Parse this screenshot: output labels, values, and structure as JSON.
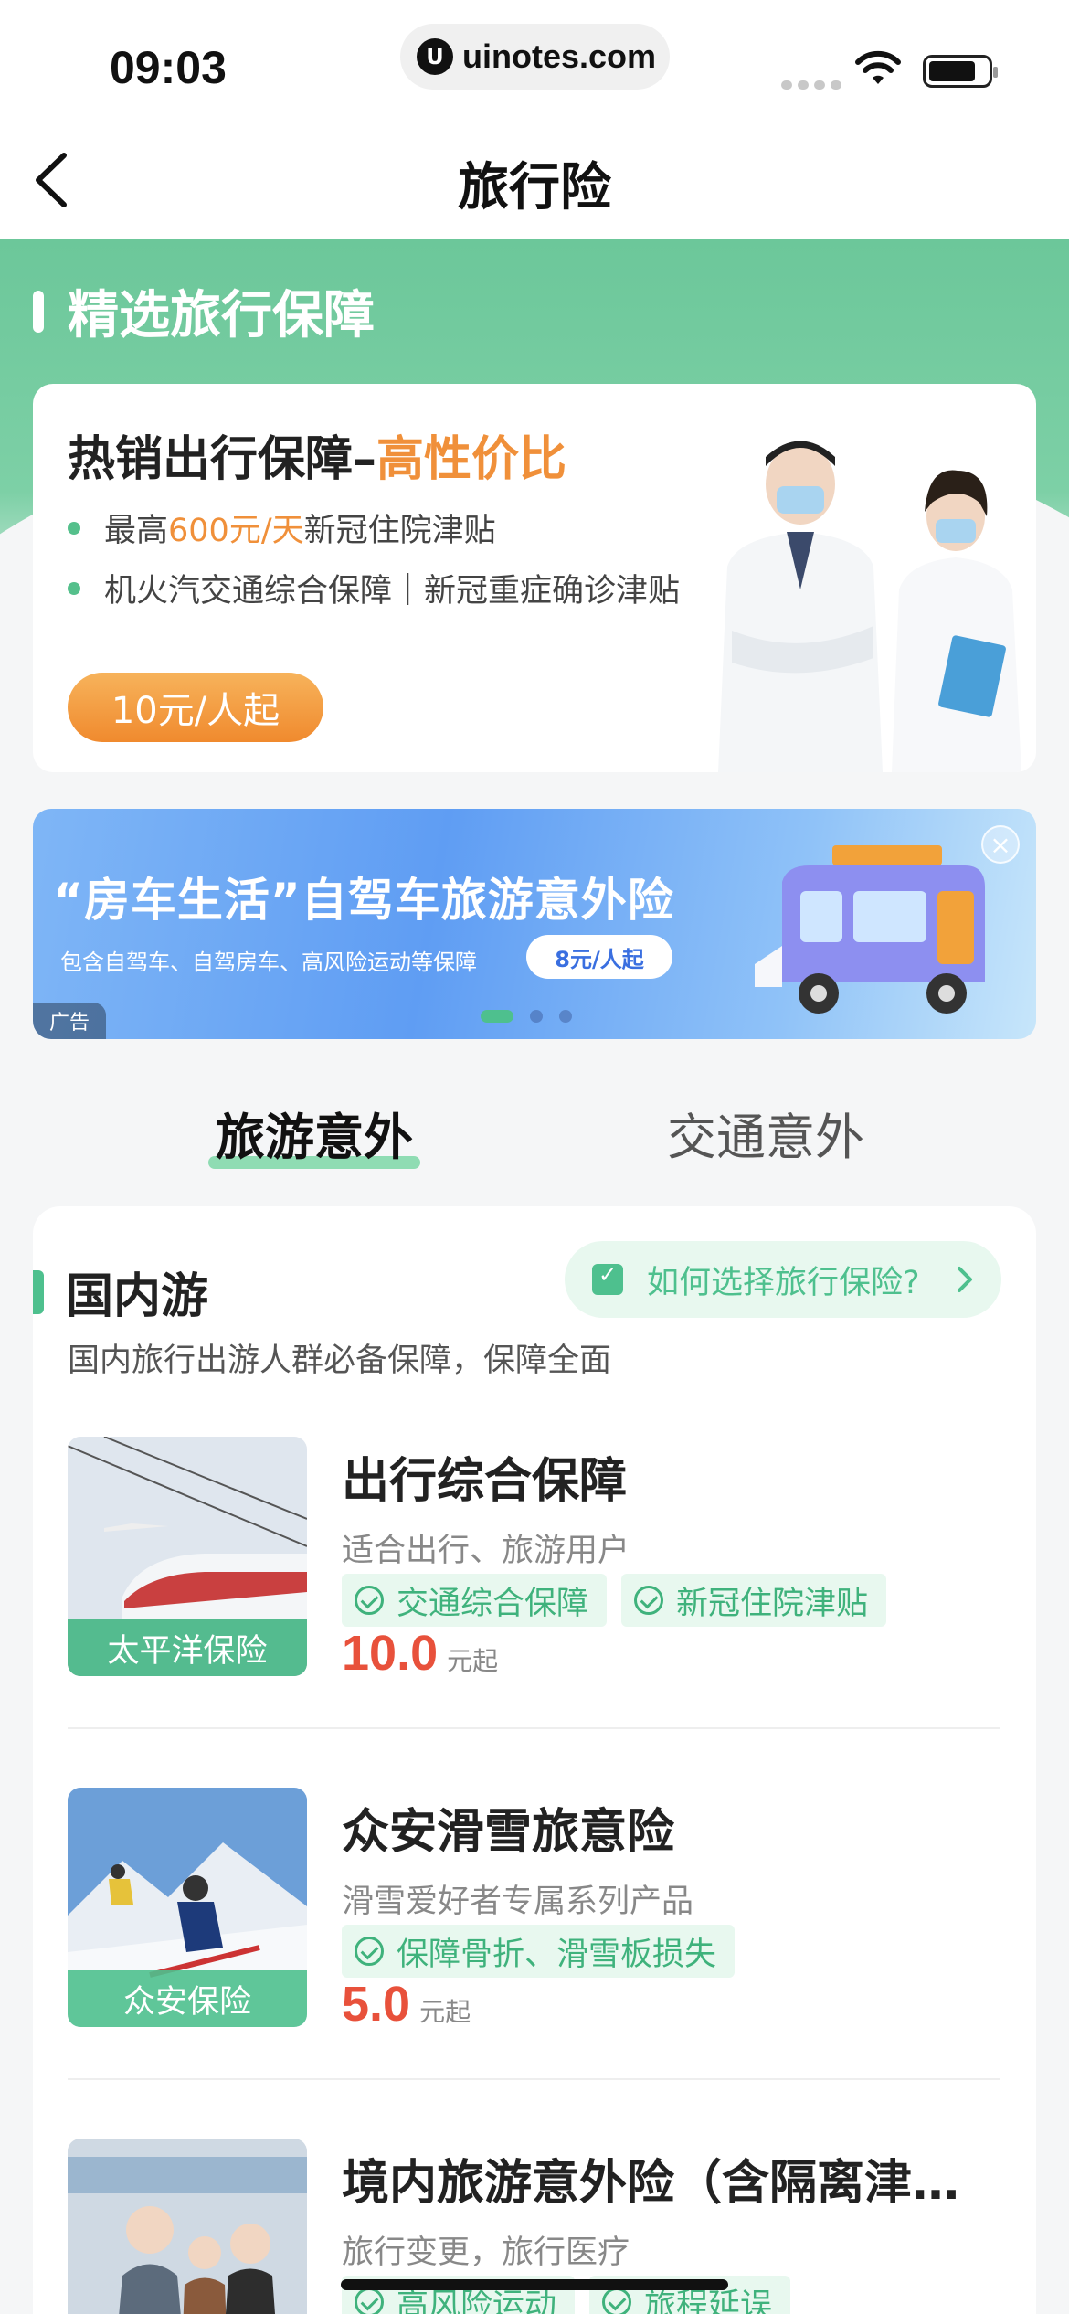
{
  "status_bar": {
    "time": "09:03",
    "url": "uinotes.com"
  },
  "nav": {
    "title": "旅行险"
  },
  "hero": {
    "section_title": "精选旅行保障"
  },
  "promo": {
    "title_prefix": "热销出行保障–",
    "title_highlight": "高性价比",
    "bullet1_pre": "最高",
    "bullet1_hl": "600元/天",
    "bullet1_post": "新冠住院津贴",
    "bullet2": "机火汽交通综合保障｜新冠重症确诊津贴",
    "button": "10元/人起"
  },
  "ad": {
    "title": "“房车生活”自驾车旅游意外险",
    "subtitle": "包含自驾车、自驾房车、高风险运动等保障",
    "price": "8元/人起",
    "tag": "广告",
    "close": "×",
    "slides": 3,
    "active_slide": 1
  },
  "tabs": [
    {
      "label": "旅游意外",
      "active": true
    },
    {
      "label": "交通意外",
      "active": false
    }
  ],
  "section": {
    "title": "国内游",
    "subtitle": "国内旅行出游人群必备保障，保障全面",
    "help_link": "如何选择旅行保险?"
  },
  "products": [
    {
      "brand": "太平洋保险",
      "name": "出行综合保障",
      "desc": "适合出行、旅游用户",
      "tags": [
        "交通综合保障",
        "新冠住院津贴"
      ],
      "price": "10.0",
      "price_unit": "元起"
    },
    {
      "brand": "众安保险",
      "name": "众安滑雪旅意险",
      "desc": "滑雪爱好者专属系列产品",
      "tags": [
        "保障骨折、滑雪板损失"
      ],
      "price": "5.0",
      "price_unit": "元起"
    },
    {
      "brand": "",
      "name": "境内旅游意外险（含隔离津…",
      "desc": "旅行变更，旅行医疗",
      "tags": [
        "高风险运动",
        "旅程延误"
      ],
      "price": "",
      "price_unit": ""
    }
  ],
  "colors": {
    "accent": "#4ec08e",
    "price": "#e8513b",
    "promo_orange": "#f0903a"
  }
}
